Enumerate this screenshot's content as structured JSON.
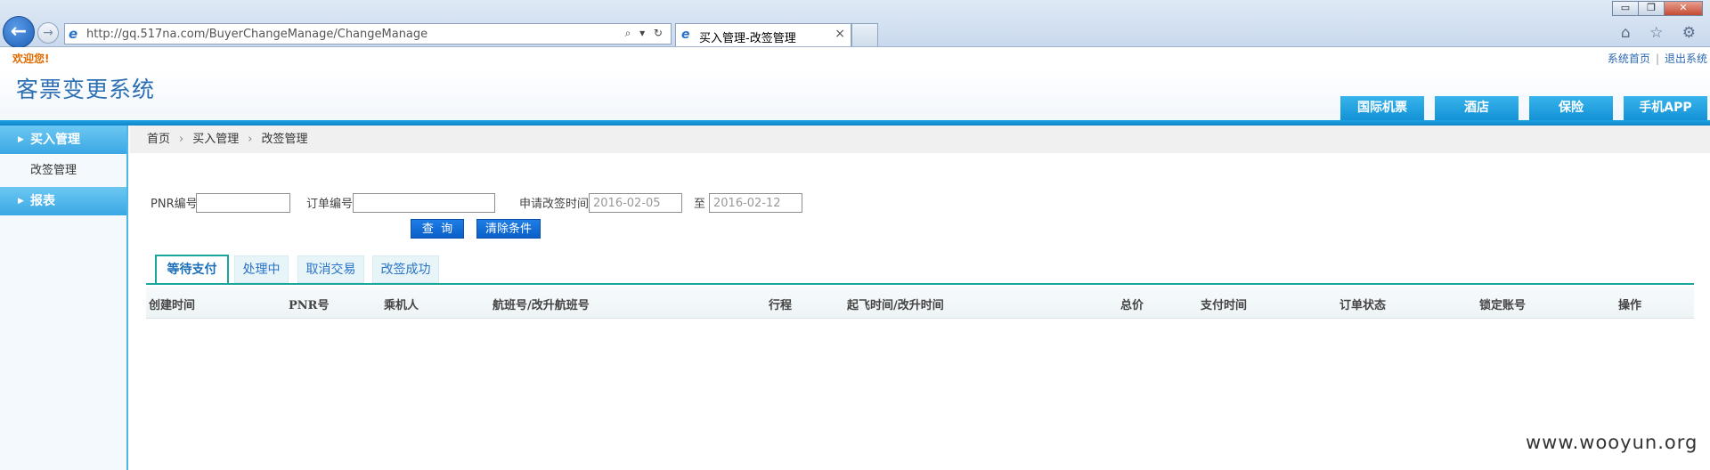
{
  "browser": {
    "url": "http://gq.517na.com/BuyerChangeManage/ChangeManage",
    "tab_title": "买入管理-改签管理",
    "tab_close": "×",
    "addr_tools": "⌕ ▾ ↻",
    "chrome_icons": "⌂ ☆ ⚙",
    "window_buttons": [
      "▭",
      "❐",
      "✕"
    ]
  },
  "site": {
    "welcome": "欢迎您!",
    "toplinks": [
      "系统首页",
      "退出系统"
    ],
    "toplink_sep": "|",
    "logo": "客票变更系统",
    "nav": [
      "国际机票",
      "酒店",
      "保险",
      "手机APP"
    ]
  },
  "sidebar": {
    "arrow": "▶",
    "groups": [
      {
        "label": "买入管理",
        "items": [
          "改签管理"
        ]
      },
      {
        "label": "报表",
        "items": []
      }
    ]
  },
  "breadcrumb": [
    "首页",
    "买入管理",
    "改签管理"
  ],
  "breadcrumb_sep": "›",
  "search": {
    "pnr_label": "PNR编号",
    "pnr_value": "",
    "order_label": "订单编号",
    "order_value": "",
    "date_label": "申请改签时间",
    "date_from": "2016-02-05",
    "date_sep": "至",
    "date_to": "2016-02-12",
    "query_button": "查  询",
    "clear_button": "清除条件"
  },
  "tabs": [
    "等待支付",
    "处理中",
    "取消交易",
    "改签成功"
  ],
  "active_tab": "等待支付",
  "table": {
    "columns": [
      "创建时间",
      "PNR号",
      "乘机人",
      "航班号/改升航班号",
      "行程",
      "起飞时间/改升时间",
      "总价",
      "支付时间",
      "订单状态",
      "锁定账号",
      "操作"
    ],
    "rows": []
  },
  "watermark": "www.wooyun.org",
  "colors": {
    "accent_blue": "#1592d6",
    "tab_teal": "#1aa69a",
    "welcome_orange": "#e06a00",
    "button_blue": "#0b5fc8"
  }
}
